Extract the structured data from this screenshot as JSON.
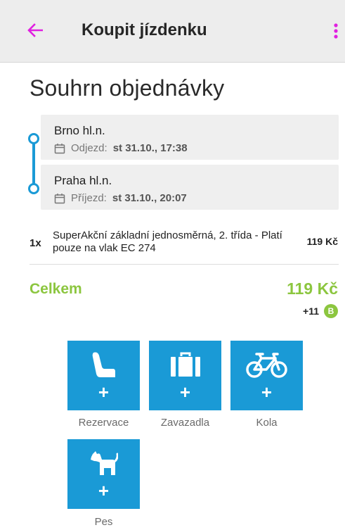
{
  "appbar": {
    "title": "Koupit jízdenku",
    "back_icon": "arrow-left-icon",
    "menu_icon": "more-vert-icon",
    "accent_color": "#e020e0"
  },
  "summary": {
    "heading": "Souhrn objednávky"
  },
  "route": {
    "departure": {
      "station": "Brno hl.n.",
      "label": "Odjezd:",
      "time": "st 31.10., 17:38"
    },
    "arrival": {
      "station": "Praha hl.n.",
      "label": "Příjezd:",
      "time": "st 31.10., 20:07"
    },
    "line_color": "#1a9ad6"
  },
  "ticket": {
    "quantity": "1x",
    "description": "SuperAkční základní jednosměrná, 2. třída - Platí pouze na vlak EC 274",
    "price": "119 Kč"
  },
  "total": {
    "label": "Celkem",
    "value": "119 Kč",
    "bonus_points": "+11",
    "bonus_badge": "B",
    "color": "#8cc63f"
  },
  "extras": {
    "tile_color": "#1a9ad6",
    "plus": "+",
    "items": [
      {
        "label": "Rezervace",
        "icon": "seat-icon"
      },
      {
        "label": "Zavazadla",
        "icon": "luggage-icon"
      },
      {
        "label": "Kola",
        "icon": "bicycle-icon"
      },
      {
        "label": "Pes",
        "icon": "dog-icon"
      }
    ]
  }
}
